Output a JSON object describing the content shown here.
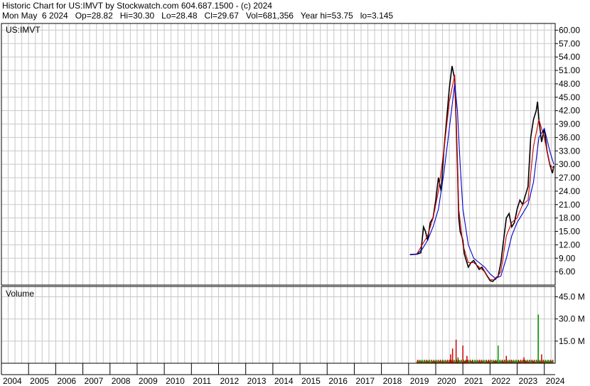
{
  "header": {
    "line1": "Historic Chart for US:IMVT by Stockwatch.com 604.687.1500 - (c) 2024",
    "line2": "Mon May  6 2024   Op=28.82   Hi=30.30   Lo=28.48   Cl=29.67   Vol=681,356   Year hi=53.75   lo=3.145"
  },
  "chart_data": {
    "type": "line",
    "price_panel": {
      "label": "US:IMVT",
      "y_ticks": [
        "60.00",
        "57.00",
        "54.00",
        "51.00",
        "48.00",
        "45.00",
        "42.00",
        "39.00",
        "36.00",
        "33.00",
        "30.00",
        "27.00",
        "24.00",
        "21.00",
        "18.00",
        "15.00",
        "12.00",
        "9.00",
        "6.00"
      ],
      "y_values": [
        60,
        57,
        54,
        51,
        48,
        45,
        42,
        39,
        36,
        33,
        30,
        27,
        24,
        21,
        18,
        15,
        12,
        9,
        6
      ],
      "ylim": [
        3,
        61.5
      ],
      "grid": true,
      "series": [
        {
          "color": "#000000",
          "x": [
            2019.05,
            2019.3,
            2019.45,
            2019.55,
            2019.62,
            2019.7,
            2019.8,
            2019.9,
            2020.0,
            2020.1,
            2020.2,
            2020.3,
            2020.4,
            2020.5,
            2020.6,
            2020.7,
            2020.75,
            2020.8,
            2020.85,
            2020.9,
            2020.95,
            2021.0,
            2021.05,
            2021.1,
            2021.2,
            2021.3,
            2021.4,
            2021.5,
            2021.6,
            2021.7,
            2021.8,
            2021.9,
            2022.0,
            2022.1,
            2022.2,
            2022.3,
            2022.4,
            2022.5,
            2022.6,
            2022.7,
            2022.8,
            2022.9,
            2023.0,
            2023.1,
            2023.2,
            2023.3,
            2023.4,
            2023.5,
            2023.6,
            2023.7,
            2023.75,
            2023.8,
            2023.9,
            2024.0,
            2024.1,
            2024.2,
            2024.3,
            2024.35
          ],
          "y": [
            9.8,
            9.9,
            10.2,
            16,
            15,
            13,
            17,
            18,
            22,
            27,
            24,
            33,
            40,
            47,
            52,
            49,
            40,
            30,
            18,
            15,
            14,
            13,
            10,
            9,
            7,
            8,
            8.5,
            7.5,
            6.5,
            7,
            6,
            5,
            4,
            3.8,
            4.5,
            5,
            8,
            13,
            18,
            19,
            16,
            17,
            20,
            22,
            21,
            23,
            25,
            36,
            40,
            42,
            44,
            40,
            35,
            38,
            33,
            30,
            28,
            29.67
          ]
        },
        {
          "color": "#cc0000",
          "x": [
            2019.05,
            2019.3,
            2019.5,
            2019.7,
            2019.9,
            2020.1,
            2020.3,
            2020.5,
            2020.7,
            2020.85,
            2021.0,
            2021.2,
            2021.4,
            2021.6,
            2021.8,
            2022.0,
            2022.2,
            2022.4,
            2022.6,
            2022.8,
            2023.0,
            2023.2,
            2023.4,
            2023.6,
            2023.8,
            2024.0,
            2024.2,
            2024.35
          ],
          "y": [
            9.8,
            9.9,
            12,
            14,
            18,
            24,
            33,
            44,
            50,
            20,
            12,
            8,
            8,
            7,
            6,
            4.2,
            4.2,
            6,
            14,
            17,
            18,
            21,
            22,
            34,
            40,
            36,
            30,
            29
          ]
        },
        {
          "color": "#0000cc",
          "x": [
            2019.05,
            2019.3,
            2019.5,
            2019.7,
            2019.9,
            2020.1,
            2020.3,
            2020.5,
            2020.7,
            2020.8,
            2020.9,
            2021.0,
            2021.2,
            2021.4,
            2021.6,
            2021.8,
            2022.0,
            2022.2,
            2022.4,
            2022.6,
            2022.8,
            2023.0,
            2023.2,
            2023.4,
            2023.6,
            2023.8,
            2024.0,
            2024.2,
            2024.35
          ],
          "y": [
            9.8,
            9.9,
            11,
            13,
            16,
            20,
            28,
            38,
            48,
            42,
            30,
            20,
            12,
            9,
            8,
            7,
            5.5,
            4.5,
            5,
            9,
            14,
            17,
            19,
            21,
            26,
            36,
            38,
            33,
            30
          ]
        }
      ]
    },
    "volume_panel": {
      "label": "Volume",
      "y_ticks": [
        "45.0 M",
        "30.0 M",
        "15.0 M"
      ],
      "y_values": [
        45,
        30,
        15
      ],
      "ylim": [
        0,
        52
      ],
      "spikes": [
        {
          "x": 2020.55,
          "v": 6,
          "color": "#cc0000"
        },
        {
          "x": 2020.62,
          "v": 10,
          "color": "#cc0000"
        },
        {
          "x": 2020.75,
          "v": 16,
          "color": "#cc0000"
        },
        {
          "x": 2020.82,
          "v": 4,
          "color": "#009900"
        },
        {
          "x": 2021.0,
          "v": 12,
          "color": "#cc0000"
        },
        {
          "x": 2021.15,
          "v": 5,
          "color": "#cc0000"
        },
        {
          "x": 2022.3,
          "v": 12,
          "color": "#009900"
        },
        {
          "x": 2022.6,
          "v": 5,
          "color": "#cc0000"
        },
        {
          "x": 2023.25,
          "v": 4,
          "color": "#cc0000"
        },
        {
          "x": 2023.78,
          "v": 33,
          "color": "#009900"
        },
        {
          "x": 2023.9,
          "v": 6,
          "color": "#cc0000"
        }
      ]
    },
    "x_axis": {
      "labels": [
        "2004",
        "2005",
        "2006",
        "2007",
        "2008",
        "2009",
        "2010",
        "2011",
        "2012",
        "2013",
        "2014",
        "2015",
        "2016",
        "2017",
        "2018",
        "2019",
        "2020",
        "2021",
        "2022",
        "2023",
        "2024"
      ],
      "years": [
        2004,
        2005,
        2006,
        2007,
        2008,
        2009,
        2010,
        2011,
        2012,
        2013,
        2014,
        2015,
        2016,
        2017,
        2018,
        2019,
        2020,
        2021,
        2022,
        2023,
        2024
      ],
      "xlim": [
        2004,
        2024.4
      ]
    }
  }
}
